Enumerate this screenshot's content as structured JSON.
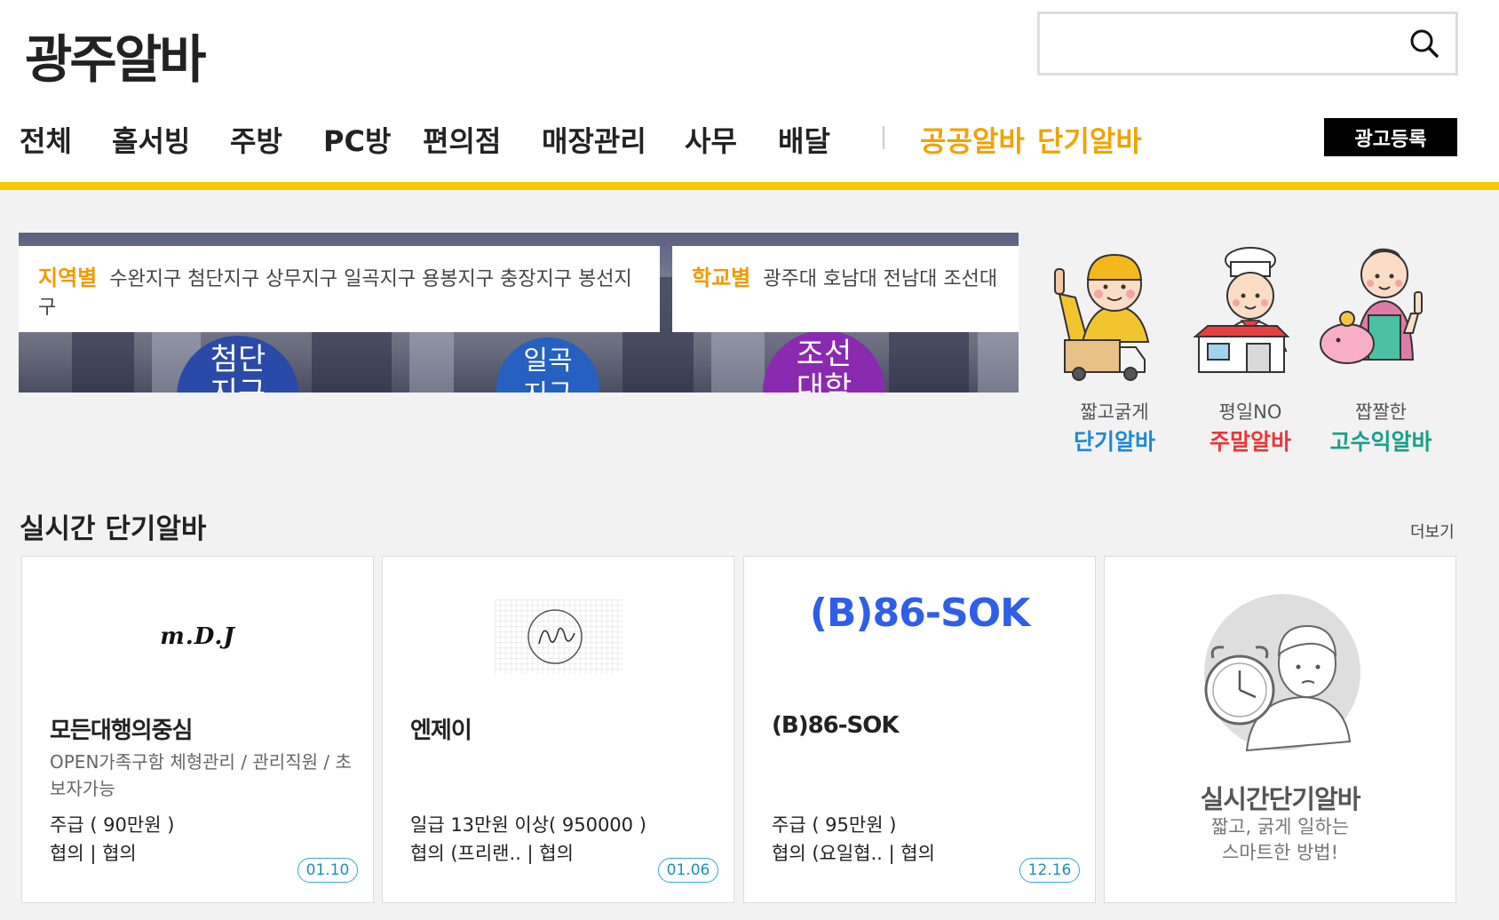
{
  "header": {
    "logo": "광주알바",
    "search": {
      "placeholder": ""
    },
    "nav": [
      "전체",
      "홀서빙",
      "주방",
      "PC방",
      "편의점",
      "매장관리",
      "사무",
      "배달"
    ],
    "nav_accent": [
      "공공알바",
      "단기알바"
    ],
    "ad_button": "광고등록"
  },
  "banner": {
    "region": {
      "title": "지역별",
      "items": "수완지구 첨단지구 상무지구 일곡지구 용봉지구 충장지구 봉선지구"
    },
    "school": {
      "title": "학교별",
      "items": "광주대 호남대 전남대 조선대"
    },
    "circles": [
      "첨단 지구",
      "일곡 지구",
      "조선 대학"
    ]
  },
  "promos": [
    {
      "line1": "짧고굵게",
      "line2": "단기알바",
      "color": "#1e88d8"
    },
    {
      "line1": "평일NO",
      "line2": "주말알바",
      "color": "#e83838"
    },
    {
      "line1": "짭짤한",
      "line2": "고수익알바",
      "color": "#17a08a"
    }
  ],
  "section": {
    "title": "실시간 단기알바",
    "more": "더보기"
  },
  "cards": [
    {
      "logo": "m.D.J",
      "name": "모든대행의중심",
      "desc": "OPEN가족구함 체형관리 / 관리직원 / 초보자가능",
      "pay": "주급 ( 90만원 )",
      "loc": "협의 | 협의",
      "date": "01.10"
    },
    {
      "logo": "",
      "name": "엔제이",
      "desc": "",
      "pay": "일급 13만원 이상( 950000 )",
      "loc": "협의 (프리랜.. | 협의",
      "date": "01.06"
    },
    {
      "logo": "(B)86-SOK",
      "name": "(B)86-SOK",
      "desc": "",
      "pay": "주급 ( 95만원 )",
      "loc": "협의 (요일협.. | 협의",
      "date": "12.16"
    }
  ],
  "promo_card": {
    "title": "실시간단기알바",
    "line1": "짧고, 굵게 일하는",
    "line2": "스마트한 방법!"
  },
  "colors": {
    "accent_yellow": "#f8c700",
    "accent_orange": "#f0a300"
  }
}
